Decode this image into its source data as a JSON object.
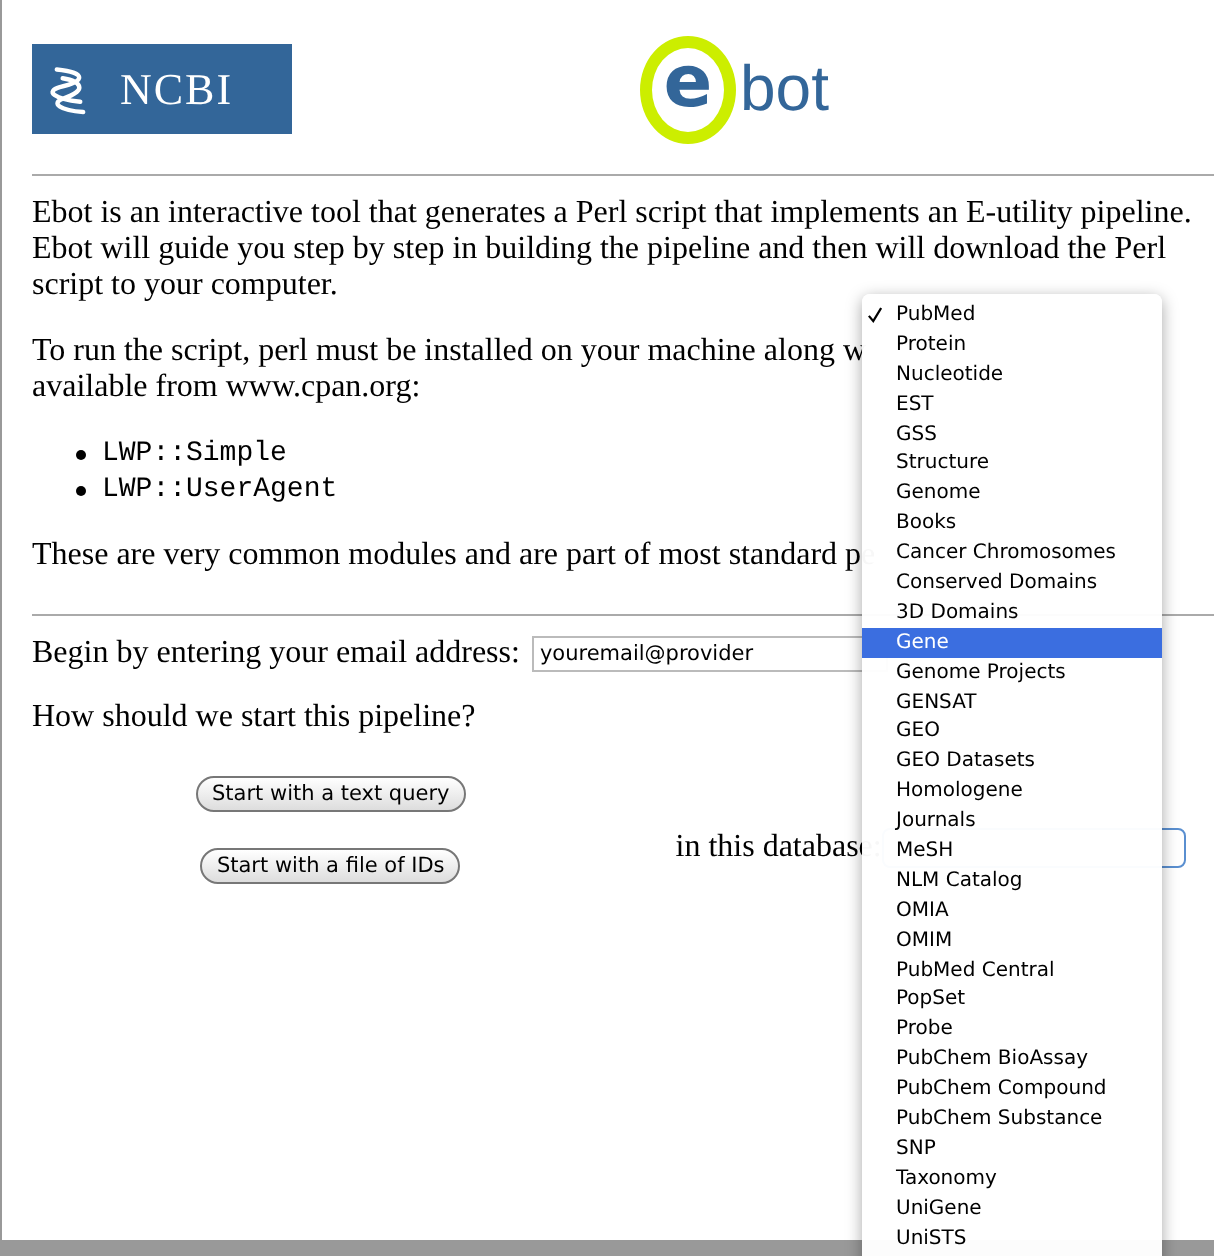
{
  "header": {
    "ncbi_logo": {
      "text": "NCBI"
    },
    "ebot_logo": {
      "mark": "e",
      "text": "bot"
    }
  },
  "intro": "Ebot is an interactive tool that generates a Perl script that implements an E-utility pipeline. Ebot will guide you step by step in building the pipeline and then will download the Perl script to your computer.",
  "requirements": [
    "To run the script, perl must be installed on your machine along w",
    "available from www.cpan.org:"
  ],
  "modules": [
    "LWP::Simple",
    "LWP::UserAgent"
  ],
  "note": "These are very common modules and are part of most standard pe",
  "email": {
    "label": "Begin by entering your email address:",
    "value": "youremail@provider"
  },
  "question": "How should we start this pipeline?",
  "buttons": [
    "Start with a text query",
    "Start with a file of IDs"
  ],
  "database_label": "in this database:",
  "database_menu": {
    "items": [
      {
        "label": "PubMed",
        "checked": true,
        "selected": false
      },
      {
        "label": "Protein",
        "checked": false,
        "selected": false
      },
      {
        "label": "Nucleotide",
        "checked": false,
        "selected": false
      },
      {
        "label": "EST",
        "checked": false,
        "selected": false
      },
      {
        "label": "GSS",
        "checked": false,
        "selected": false
      },
      {
        "label": "Structure",
        "checked": false,
        "selected": false
      },
      {
        "label": "Genome",
        "checked": false,
        "selected": false
      },
      {
        "label": "Books",
        "checked": false,
        "selected": false
      },
      {
        "label": "Cancer Chromosomes",
        "checked": false,
        "selected": false
      },
      {
        "label": "Conserved Domains",
        "checked": false,
        "selected": false
      },
      {
        "label": "3D Domains",
        "checked": false,
        "selected": false
      },
      {
        "label": "Gene",
        "checked": false,
        "selected": true
      },
      {
        "label": "Genome Projects",
        "checked": false,
        "selected": false
      },
      {
        "label": "GENSAT",
        "checked": false,
        "selected": false
      },
      {
        "label": "GEO",
        "checked": false,
        "selected": false
      },
      {
        "label": "GEO Datasets",
        "checked": false,
        "selected": false
      },
      {
        "label": "Homologene",
        "checked": false,
        "selected": false
      },
      {
        "label": "Journals",
        "checked": false,
        "selected": false
      },
      {
        "label": "MeSH",
        "checked": false,
        "selected": false
      },
      {
        "label": "NLM Catalog",
        "checked": false,
        "selected": false
      },
      {
        "label": "OMIA",
        "checked": false,
        "selected": false
      },
      {
        "label": "OMIM",
        "checked": false,
        "selected": false
      },
      {
        "label": "PubMed Central",
        "checked": false,
        "selected": false
      },
      {
        "label": "PopSet",
        "checked": false,
        "selected": false
      },
      {
        "label": "Probe",
        "checked": false,
        "selected": false
      },
      {
        "label": "PubChem BioAssay",
        "checked": false,
        "selected": false
      },
      {
        "label": "PubChem Compound",
        "checked": false,
        "selected": false
      },
      {
        "label": "PubChem Substance",
        "checked": false,
        "selected": false
      },
      {
        "label": "SNP",
        "checked": false,
        "selected": false
      },
      {
        "label": "Taxonomy",
        "checked": false,
        "selected": false
      },
      {
        "label": "UniGene",
        "checked": false,
        "selected": false
      },
      {
        "label": "UniSTS",
        "checked": false,
        "selected": false
      }
    ]
  }
}
